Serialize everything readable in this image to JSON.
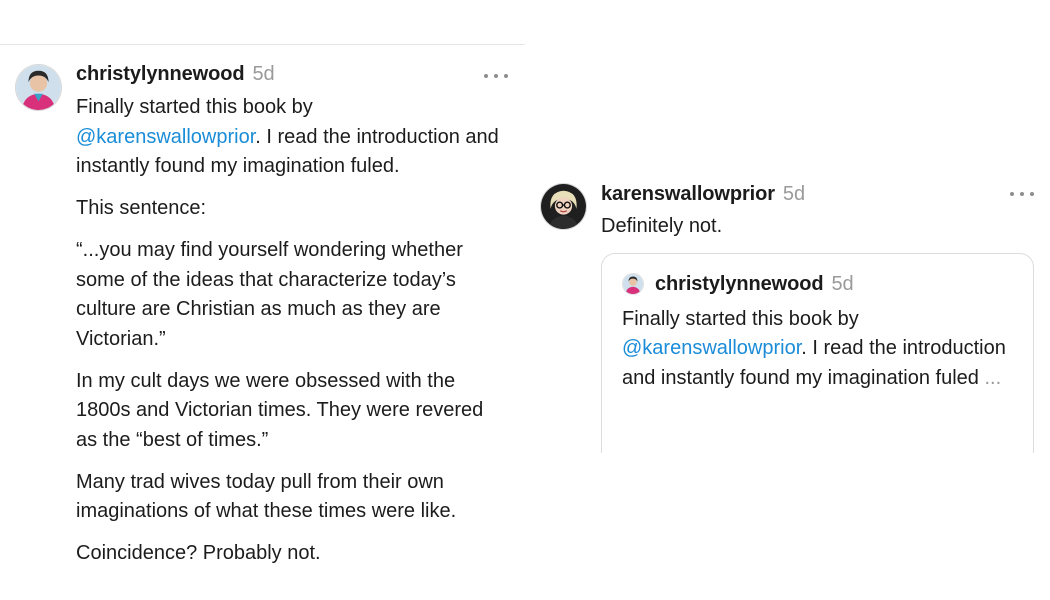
{
  "post": {
    "author": "christylynnewood",
    "time": "5d",
    "para1_before": "Finally started this book by",
    "mention": "@karenswallowprior",
    "para1_after": ". I read the introduction and instantly found my imagination fuled.",
    "para2": "This sentence:",
    "para3": "“...you may find yourself wondering whether some of the ideas that characterize today’s culture are Christian as much as they are Victorian.”",
    "para4": "In my cult days we were obsessed with the 1800s and Victorian times. They were revered as the “best of times.”",
    "para5": "Many trad wives today pull from their own imaginations of what these times were like.",
    "para6": "Coincidence? Probably not."
  },
  "reply": {
    "author": "karenswallowprior",
    "time": "5d",
    "text": "Definitely not.",
    "quote": {
      "author": "christylynnewood",
      "time": "5d",
      "text_before": "Finally started this book by",
      "mention": "@karenswallowprior",
      "text_after": ". I read the introduction and instantly found my imagination fuled",
      "ellipsis": "..."
    }
  },
  "colors": {
    "mention": "#1a8cd8",
    "muted": "#9a9a9a",
    "text": "#1c1c1c",
    "border": "#dcdcdc"
  },
  "icons": {
    "post_avatar": "christylynnewood-avatar",
    "reply_avatar": "karenswallowprior-avatar",
    "more": "more-horizontal-icon"
  }
}
